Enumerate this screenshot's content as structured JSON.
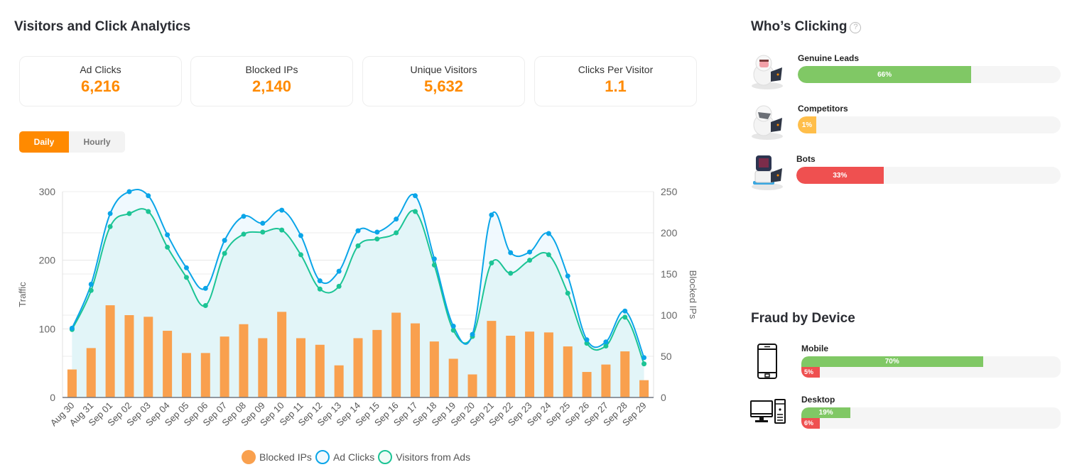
{
  "header": {
    "title": "Visitors and Click Analytics"
  },
  "stats": [
    {
      "label": "Ad Clicks",
      "value": "6,216"
    },
    {
      "label": "Blocked IPs",
      "value": "2,140"
    },
    {
      "label": "Unique Visitors",
      "value": "5,632"
    },
    {
      "label": "Clicks Per Visitor",
      "value": "1.1"
    }
  ],
  "toggle": {
    "daily": "Daily",
    "hourly": "Hourly",
    "selected": "Daily"
  },
  "colors": {
    "accent": "#ff8a00",
    "blocked": "#f9a04e",
    "ad_clicks": "#0aa5e8",
    "visitors": "#1cc495",
    "good": "#80c865",
    "bad": "#ef5050",
    "warn": "#ffbe4a"
  },
  "chart_data": {
    "type": "bar+line",
    "title": "",
    "xlabel": "",
    "ylabel": "Traffic",
    "y2label": "Blocked IPs",
    "ylim": [
      0,
      300
    ],
    "y2lim": [
      0,
      250
    ],
    "yticks": [
      "0",
      "100",
      "200",
      "300"
    ],
    "y2ticks": [
      "0",
      "50",
      "100",
      "150",
      "200",
      "250"
    ],
    "grid": true,
    "legend_position": "bottom-center",
    "categories": [
      "Aug 30",
      "Aug 31",
      "Sep 01",
      "Sep 02",
      "Sep 03",
      "Sep 04",
      "Sep 05",
      "Sep 06",
      "Sep 07",
      "Sep 08",
      "Sep 09",
      "Sep 10",
      "Sep 11",
      "Sep 12",
      "Sep 13",
      "Sep 14",
      "Sep 15",
      "Sep 16",
      "Sep 17",
      "Sep 18",
      "Sep 19",
      "Sep 20",
      "Sep 21",
      "Sep 22",
      "Sep 23",
      "Sep 24",
      "Sep 25",
      "Sep 26",
      "Sep 27",
      "Sep 28",
      "Sep 29"
    ],
    "series": [
      {
        "name": "Blocked IPs",
        "type": "bar",
        "axis": "right",
        "values": [
          34,
          60,
          112,
          100,
          98,
          81,
          54,
          54,
          74,
          89,
          72,
          104,
          72,
          64,
          39,
          72,
          82,
          103,
          90,
          68,
          47,
          28,
          93,
          75,
          80,
          79,
          62,
          31,
          40,
          56,
          21
        ]
      },
      {
        "name": "Ad Clicks",
        "type": "line",
        "axis": "left",
        "values": [
          101,
          165,
          268,
          300,
          294,
          237,
          189,
          159,
          229,
          264,
          254,
          273,
          236,
          170,
          184,
          243,
          241,
          260,
          294,
          202,
          104,
          92,
          266,
          211,
          212,
          239,
          177,
          84,
          81,
          126,
          58
        ]
      },
      {
        "name": "Visitors from Ads",
        "type": "line",
        "axis": "left",
        "values": [
          99,
          156,
          249,
          268,
          271,
          219,
          175,
          134,
          210,
          238,
          241,
          244,
          208,
          158,
          162,
          221,
          231,
          240,
          271,
          193,
          98,
          89,
          196,
          181,
          200,
          208,
          152,
          79,
          75,
          117,
          49
        ]
      }
    ]
  },
  "who_clicking": {
    "title": "Who’s Clicking",
    "help_icon": "?",
    "rows": [
      {
        "label": "Genuine Leads",
        "percent": 66,
        "text": "66%",
        "color": "#80c865",
        "avatar": "person-avatar"
      },
      {
        "label": "Competitors",
        "percent": 1,
        "text": "1%",
        "color": "#ffbe4a",
        "avatar": "competitor-avatar"
      },
      {
        "label": "Bots",
        "percent": 33,
        "text": "33%",
        "color": "#ef5050",
        "avatar": "robot-avatar"
      }
    ]
  },
  "fraud_by_device": {
    "title": "Fraud by Device",
    "rows": [
      {
        "label": "Mobile",
        "icon": "mobile-phone-icon",
        "good_percent": 70,
        "good_text": "70%",
        "bad_percent": 5,
        "bad_text": "5%"
      },
      {
        "label": "Desktop",
        "icon": "desktop-computer-icon",
        "good_percent": 19,
        "good_text": "19%",
        "bad_percent": 6,
        "bad_text": "6%"
      }
    ]
  }
}
